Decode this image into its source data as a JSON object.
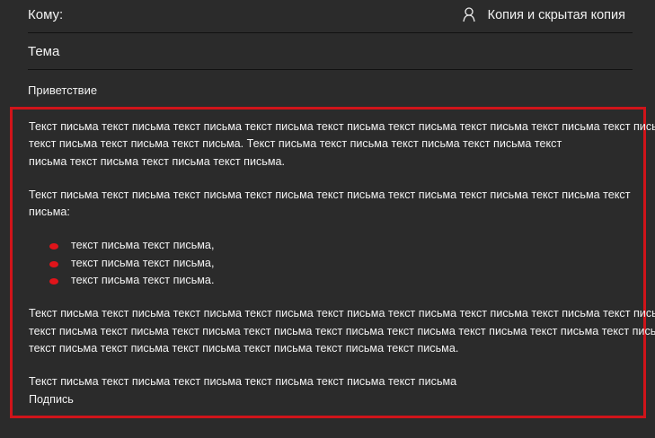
{
  "to_label": "Кому:",
  "cc_bcc_label": "Копия и скрытая копия",
  "subject_placeholder": "Тема",
  "greeting": "Приветствие",
  "body": {
    "p1": [
      "Текст письма текст письма текст письма текст письма текст письма текст письма текст письма текст письма текст письма",
      "текст письма текст письма текст письма. Текст письма текст письма текст письма текст письма текст",
      "письма текст письма текст письма текст письма."
    ],
    "p2": [
      "Текст письма текст письма текст письма текст письма текст письма текст письма текст письма текст письма текст",
      "письма:"
    ],
    "bullets": [
      "текст письма текст письма,",
      "текст письма текст письма,",
      "текст письма текст письма."
    ],
    "p3": [
      "Текст письма текст письма текст письма текст письма текст письма текст письма текст письма текст письма текст письма",
      "текст письма текст письма текст письма текст письма текст письма текст письма текст письма текст письма текст письма",
      "текст письма текст письма текст письма текст письма текст письма текст письма."
    ],
    "p4": "Текст письма текст письма текст письма текст письма текст письма текст письма",
    "signature": "Подпись"
  },
  "colors": {
    "highlight": "#d0141a",
    "background": "#2b2b2b"
  }
}
